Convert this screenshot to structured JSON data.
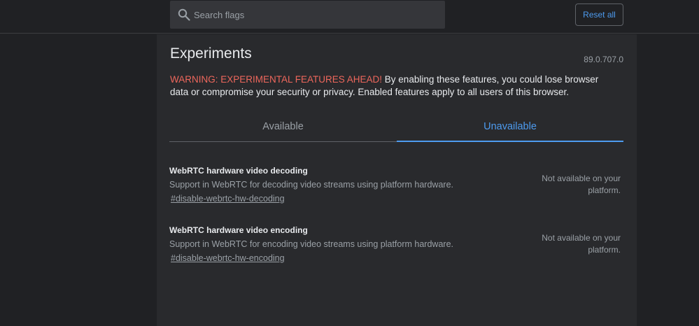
{
  "search": {
    "placeholder": "Search flags",
    "value": ""
  },
  "header": {
    "reset_label": "Reset all"
  },
  "main": {
    "title": "Experiments",
    "version": "89.0.707.0",
    "warning_strong": "WARNING: EXPERIMENTAL FEATURES AHEAD!",
    "warning_text": " By enabling these features, you could lose browser data or compromise your security or privacy. Enabled features apply to all users of this browser.",
    "tabs": [
      {
        "label": "Available",
        "selected": false
      },
      {
        "label": "Unavailable",
        "selected": true
      }
    ],
    "flags": [
      {
        "name": "WebRTC hardware video decoding",
        "description": "Support in WebRTC for decoding video streams using platform hardware.",
        "link": "#disable-webrtc-hw-decoding",
        "status": "Not available on your platform."
      },
      {
        "name": "WebRTC hardware video encoding",
        "description": "Support in WebRTC for encoding video streams using platform hardware.",
        "link": "#disable-webrtc-hw-encoding",
        "status": "Not available on your platform."
      }
    ]
  },
  "colors": {
    "background": "#202124",
    "panel": "#292a2d",
    "accent": "#4d9bef",
    "warning": "#ee675c"
  },
  "icons": {
    "search": "search-icon"
  }
}
